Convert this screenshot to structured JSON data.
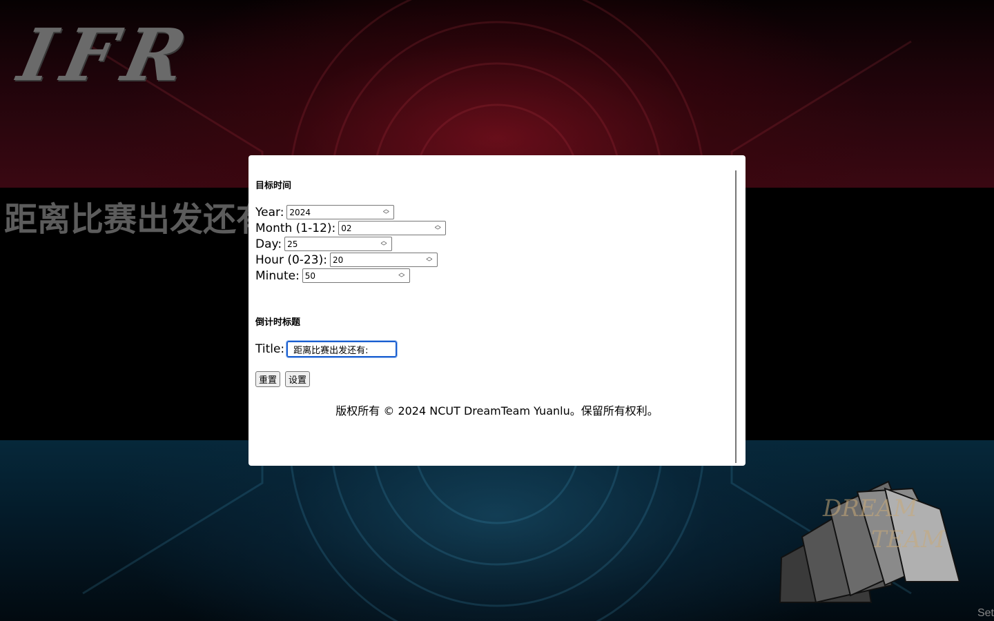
{
  "background": {
    "logo_text": "IFR",
    "big_title": "距离比赛出发还有",
    "corner_text": "Set",
    "dream_logo_text": "DREAM TEAM",
    "colors": {
      "top_band": "#3a0812",
      "bottom_band": "#06283a",
      "logo_gray": "#6a6a6a"
    }
  },
  "modal": {
    "target_heading": "目标时间",
    "fields": {
      "year": {
        "label": "Year:",
        "value": "2024"
      },
      "month": {
        "label": "Month (1-12):",
        "value": "02"
      },
      "day": {
        "label": "Day:",
        "value": "25"
      },
      "hour": {
        "label": "Hour (0-23):",
        "value": "20"
      },
      "minute": {
        "label": "Minute:",
        "value": "50"
      }
    },
    "title_heading": "倒计时标题",
    "title_field": {
      "label": "Title:",
      "value": "距离比赛出发还有:"
    },
    "buttons": {
      "reset": "重置",
      "set": "设置"
    },
    "copyright": "版权所有 © 2024 NCUT DreamTeam Yuanlu。保留所有权利。",
    "colors": {
      "focus_border": "#1a5fd0"
    }
  }
}
